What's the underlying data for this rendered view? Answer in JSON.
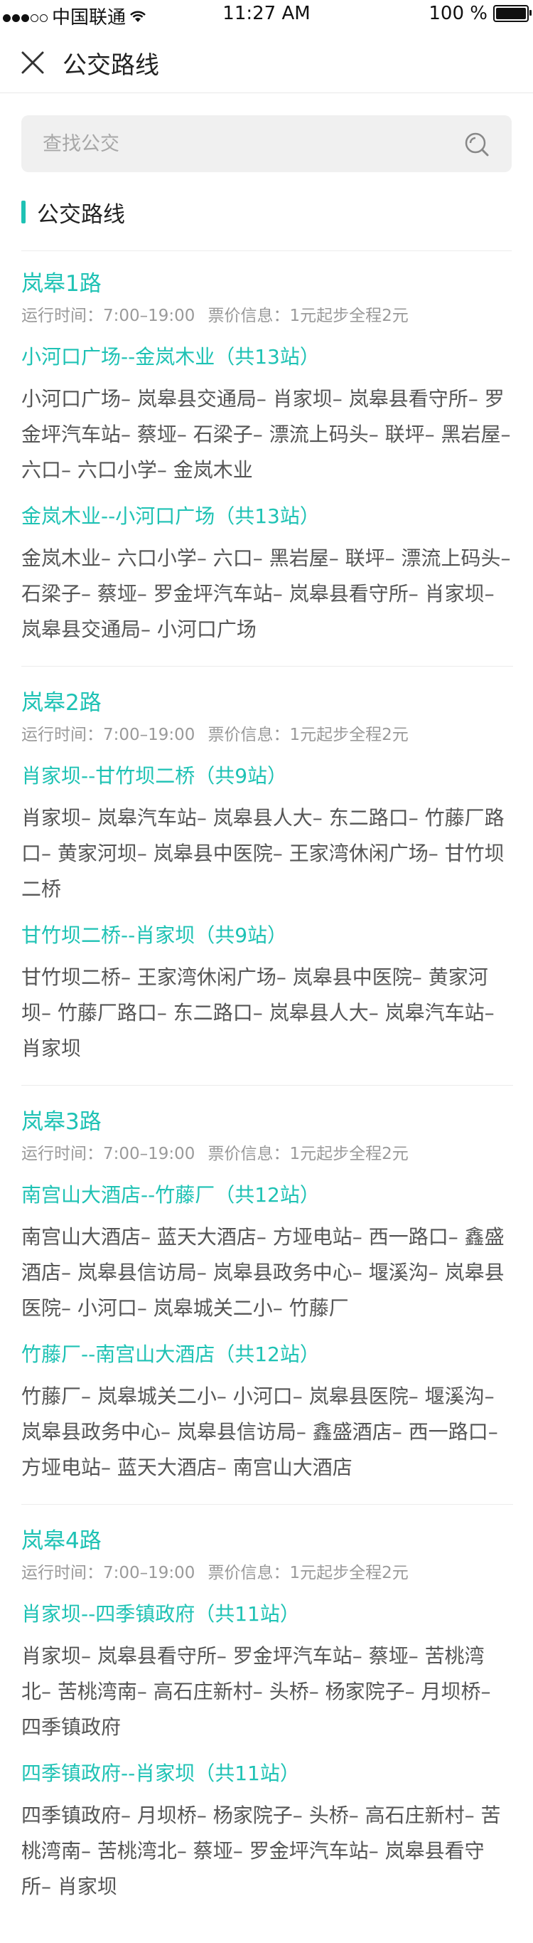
{
  "status_bar": {
    "carrier": "中国联通",
    "time": "11:27 AM",
    "battery": "100 %"
  },
  "navbar": {
    "title": "公交路线"
  },
  "search": {
    "placeholder": "查找公交"
  },
  "section": {
    "title": "公交路线"
  },
  "routes": [
    {
      "name": "岚皋1路",
      "hours": "运行时间：7:00–19:00",
      "fare": "票价信息：1元起步全程2元",
      "directions": [
        {
          "title": "小河口广场--金岚木业（共13站）",
          "stops": "小河口广场– 岚皋县交通局– 肖家坝– 岚皋县看守所– 罗金坪汽车站– 蔡垭– 石梁子– 漂流上码头– 联坪– 黑岩屋– 六口– 六口小学– 金岚木业"
        },
        {
          "title": "金岚木业--小河口广场（共13站）",
          "stops": "金岚木业– 六口小学– 六口– 黑岩屋– 联坪– 漂流上码头– 石梁子– 蔡垭– 罗金坪汽车站– 岚皋县看守所– 肖家坝– 岚皋县交通局– 小河口广场"
        }
      ]
    },
    {
      "name": "岚皋2路",
      "hours": "运行时间：7:00–19:00",
      "fare": "票价信息：1元起步全程2元",
      "directions": [
        {
          "title": "肖家坝--甘竹坝二桥（共9站）",
          "stops": "肖家坝– 岚皋汽车站– 岚皋县人大– 东二路口– 竹藤厂路口– 黄家河坝– 岚皋县中医院– 王家湾休闲广场– 甘竹坝二桥"
        },
        {
          "title": "甘竹坝二桥--肖家坝（共9站）",
          "stops": "甘竹坝二桥– 王家湾休闲广场– 岚皋县中医院– 黄家河坝– 竹藤厂路口– 东二路口– 岚皋县人大– 岚皋汽车站– 肖家坝"
        }
      ]
    },
    {
      "name": "岚皋3路",
      "hours": "运行时间：7:00–19:00",
      "fare": "票价信息：1元起步全程2元",
      "directions": [
        {
          "title": "南宫山大酒店--竹藤厂（共12站）",
          "stops": "南宫山大酒店– 蓝天大酒店– 方垭电站– 西一路口– 鑫盛酒店– 岚皋县信访局– 岚皋县政务中心– 堰溪沟– 岚皋县医院– 小河口– 岚皋城关二小– 竹藤厂"
        },
        {
          "title": "竹藤厂--南宫山大酒店（共12站）",
          "stops": "竹藤厂– 岚皋城关二小– 小河口– 岚皋县医院– 堰溪沟– 岚皋县政务中心– 岚皋县信访局– 鑫盛酒店– 西一路口– 方垭电站– 蓝天大酒店– 南宫山大酒店"
        }
      ]
    },
    {
      "name": "岚皋4路",
      "hours": "运行时间：7:00–19:00",
      "fare": "票价信息：1元起步全程2元",
      "directions": [
        {
          "title": "肖家坝--四季镇政府（共11站）",
          "stops": "肖家坝– 岚皋县看守所– 罗金坪汽车站– 蔡垭– 苦桃湾北– 苦桃湾南– 高石庄新村– 头桥– 杨家院子– 月坝桥– 四季镇政府"
        },
        {
          "title": "四季镇政府--肖家坝（共11站）",
          "stops": "四季镇政府– 月坝桥– 杨家院子– 头桥– 高石庄新村– 苦桃湾南– 苦桃湾北– 蔡垭– 罗金坪汽车站– 岚皋县看守所– 肖家坝"
        }
      ]
    }
  ]
}
